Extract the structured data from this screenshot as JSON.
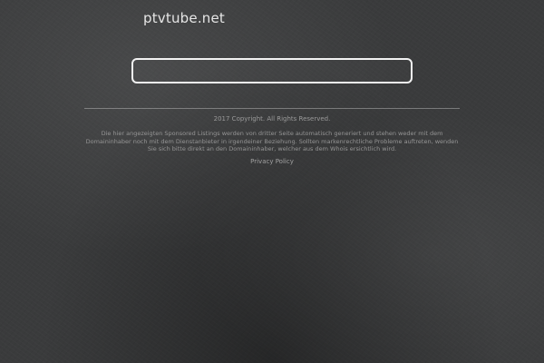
{
  "header": {
    "site_title": "ptvtube.net"
  },
  "search": {
    "value": "",
    "placeholder": ""
  },
  "footer": {
    "copyright": "2017 Copyright. All Rights Reserved.",
    "disclaimer": "Die hier angezeigten Sponsored Listings werden von dritter Seite automatisch generiert und stehen weder mit dem Domaininhaber noch mit dem Dienstanbieter in irgendeiner Beziehung. Sollten markenrechtliche Probleme auftreten, wenden Sie sich bitte direkt an den Domaininhaber, welcher aus dem Whois ersichtlich wird.",
    "privacy_label": "Privacy Policy"
  },
  "colors": {
    "background": "#3a3b3c",
    "search_border": "#f2f2f2",
    "title_text": "#e6e6e6",
    "footer_text": "#9a9a9a"
  }
}
